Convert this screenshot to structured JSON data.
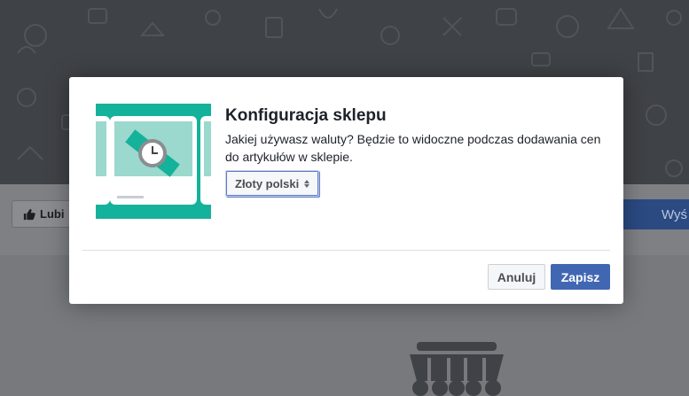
{
  "background": {
    "like_label": "Lubi",
    "send_label": "Wyś"
  },
  "dialog": {
    "title": "Konfiguracja sklepu",
    "description": "Jakiej używasz waluty? Będzie to widoczne podczas dodawania cen do artykułów w sklepie.",
    "currency_selected": "Złoty polski",
    "cancel_label": "Anuluj",
    "save_label": "Zapisz"
  },
  "colors": {
    "illustration_bg": "#14b29a",
    "primary_button": "#4267b2",
    "overlay": "#8c8e92"
  },
  "icons": [
    "thumbs-up-icon",
    "watch-icon",
    "shop-awning-icon",
    "caret-updown-icon"
  ]
}
